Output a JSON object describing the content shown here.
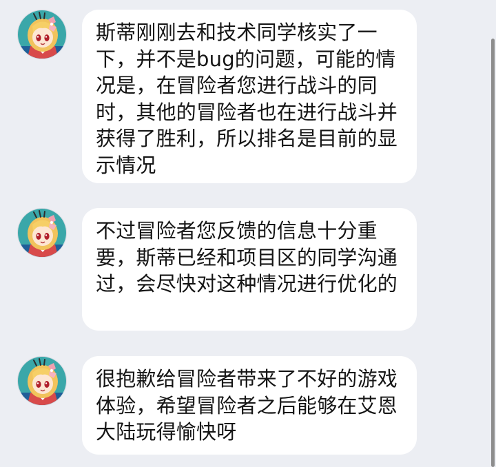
{
  "chat": {
    "messages": [
      {
        "sender_avatar": "anime-girl-avatar",
        "text": "斯蒂刚刚去和技术同学核实了一下，并不是bug的问题，可能的情况是，在冒险者您进行战斗的同时，其他的冒险者也在进行战斗并获得了胜利，所以排名是目前的显示情况"
      },
      {
        "sender_avatar": "anime-girl-avatar",
        "text": "不过冒险者您反馈的信息十分重要，斯蒂已经和项目区的同学沟通过，会尽快对这种情况进行优化的"
      },
      {
        "sender_avatar": "anime-girl-avatar",
        "text": "很抱歉给冒险者带来了不好的游戏体验，希望冒险者之后能够在艾恩大陆玩得愉快呀"
      }
    ]
  },
  "colors": {
    "background": "#eceef3",
    "bubble": "#ffffff",
    "text": "#151515",
    "scrollbar": "#8d8d8d"
  }
}
